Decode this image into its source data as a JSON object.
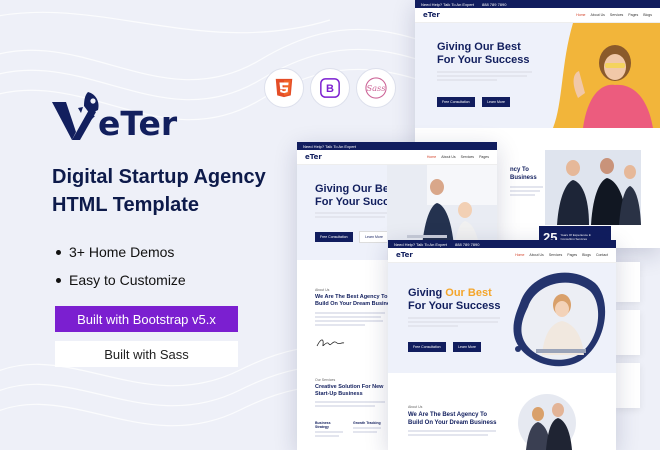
{
  "brand": {
    "logo_text": "eTer"
  },
  "headline": {
    "line1": "Digital Startup Agency",
    "line2": "HTML Template"
  },
  "features": [
    "3+ Home Demos",
    "Easy to Customize"
  ],
  "badges": {
    "bootstrap": "Built with Bootstrap v5.x",
    "sass": "Built with Sass"
  },
  "tech_icons": [
    "html5-icon",
    "bootstrap-icon",
    "sass-icon"
  ],
  "colors": {
    "primary": "#111d5e",
    "accent": "#7b1fd0",
    "highlight": "#f4a52b",
    "background": "#eef0f8"
  },
  "shot1": {
    "topbar": "Need Help? Talk To An Expert",
    "topbar_phone": "888 789 7890",
    "nav": [
      "Home",
      "About Us",
      "Services",
      "Pages",
      "Blogs"
    ],
    "hero_line1": "Giving Our Best",
    "hero_line2": "For Your Success",
    "btn1": "Free Consultation",
    "btn2": "Learn More",
    "section_title_1": "ncy To",
    "section_title_2": "Business",
    "years_number": "25",
    "years_label": "Years Of Experience In Consulting Services"
  },
  "shot2": {
    "topbar": "Need Help? Talk To An Expert",
    "hero_line1": "Giving Our Best",
    "hero_line2": "For Your Success",
    "btn1": "Free Consultation",
    "btn2": "Learn More",
    "about_kicker": "About Us",
    "about_title_1": "We Are The Best Agency To",
    "about_title_2": "Build On Your Dream Business",
    "services_kicker": "Our Services",
    "services_title_1": "Creative Solution For New",
    "services_title_2": "Start-Up Business",
    "service_a": "Business Strategy",
    "service_b": "Growth Tracking"
  },
  "shot3": {
    "topbar": "Need Help? Talk To An Expert",
    "topbar_phone": "888 789 7890",
    "nav": [
      "Home",
      "About Us",
      "Services",
      "Pages",
      "Blogs",
      "Contact"
    ],
    "hero_line1a": "Giving ",
    "hero_line1b": "Our Best",
    "hero_line2": "For Your Success",
    "btn1": "Free Consultation",
    "btn2": "Learn More",
    "about_kicker": "About Us",
    "about_title_1": "We Are The Best Agency To",
    "about_title_2": "Build On Your Dream Business"
  }
}
